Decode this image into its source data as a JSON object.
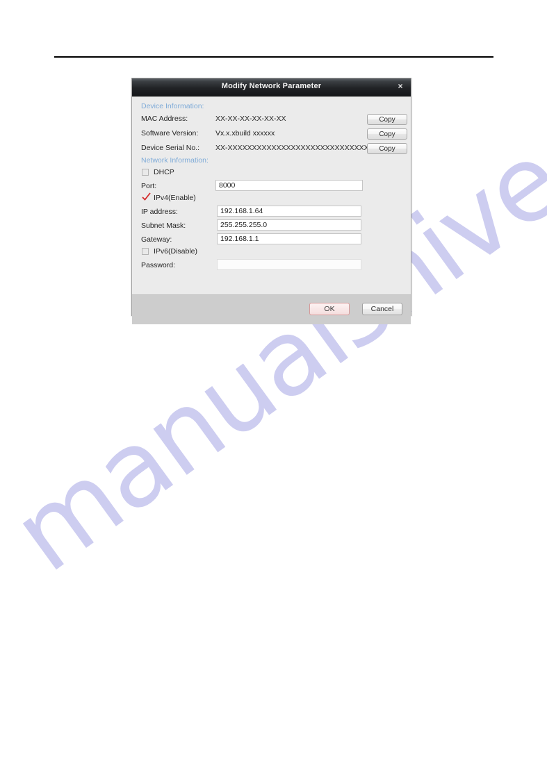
{
  "page": {
    "background_color": "#ffffff",
    "rule_color": "#000000"
  },
  "watermark": {
    "text": "manualshive.com",
    "color": "#c9c9ef"
  },
  "dialog": {
    "title": "Modify Network Parameter",
    "close_icon": "×",
    "sections": {
      "device_information_label": "Device Information:",
      "network_information_label": "Network Information:"
    },
    "device_information": {
      "rows": [
        {
          "label": "MAC Address:",
          "value": "XX-XX-XX-XX-XX-XX",
          "button": "Copy"
        },
        {
          "label": "Software Version:",
          "value": "Vx.x.xbuild xxxxxx",
          "button": "Copy"
        },
        {
          "label": "Device Serial No.:",
          "value": "XX-XXXXXXXXXXXXXXXXXXXXXXXXXXXXXX",
          "button": "Copy"
        }
      ]
    },
    "network_information": {
      "dhcp": {
        "label": "DHCP",
        "checked": false
      },
      "port": {
        "label": "Port:",
        "value": "8000"
      },
      "ipv4": {
        "label": "IPv4(Enable)",
        "checked": true
      },
      "ip_address": {
        "label": "IP address:",
        "value": "192.168.1.64"
      },
      "subnet_mask": {
        "label": "Subnet Mask:",
        "value": "255.255.255.0"
      },
      "gateway": {
        "label": "Gateway:",
        "value": "192.168.1.1"
      },
      "ipv6": {
        "label": "IPv6(Disable)",
        "checked": false
      },
      "password": {
        "label": "Password:",
        "value": ""
      }
    },
    "footer": {
      "ok_label": "OK",
      "cancel_label": "Cancel"
    },
    "accent_colors": {
      "section_label": "#7fabd8",
      "check_mark": "#d42a2a",
      "ok_border": "#d79a9a"
    }
  }
}
